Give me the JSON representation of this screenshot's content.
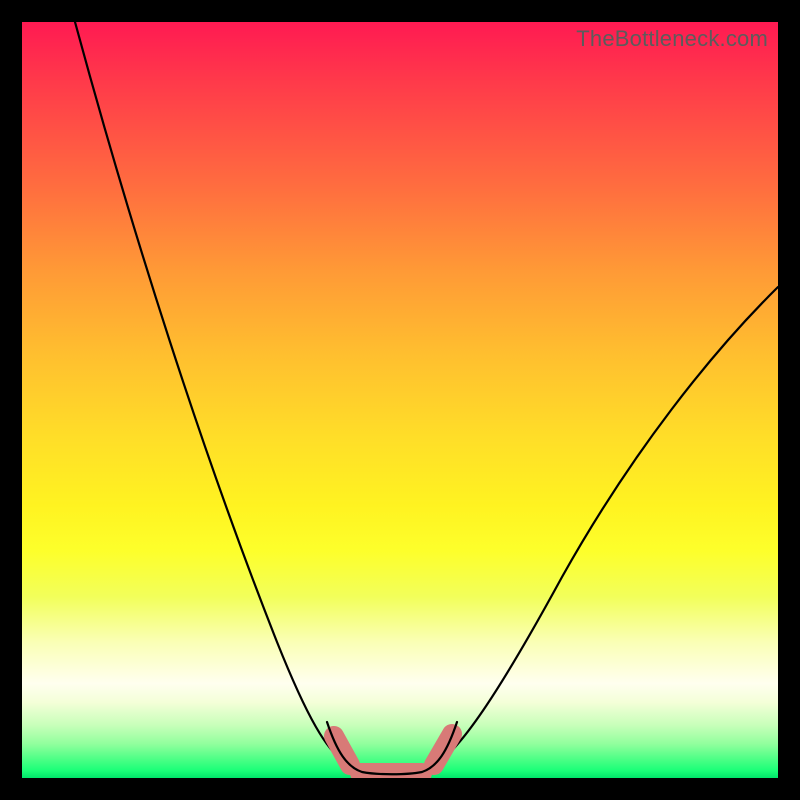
{
  "watermark": "TheBottleneck.com",
  "chart_data": {
    "type": "line",
    "title": "",
    "xlabel": "",
    "ylabel": "",
    "xlim": [
      0,
      100
    ],
    "ylim": [
      0,
      100
    ],
    "grid": false,
    "legend": false,
    "background_gradient_stops": [
      {
        "pos": 0,
        "color": "#ff1a52"
      },
      {
        "pos": 22,
        "color": "#ff6e3f"
      },
      {
        "pos": 44,
        "color": "#ffbf2f"
      },
      {
        "pos": 64,
        "color": "#fff321"
      },
      {
        "pos": 82,
        "color": "#faffb5"
      },
      {
        "pos": 90,
        "color": "#f4ffd8"
      },
      {
        "pos": 97.5,
        "color": "#4dff86"
      },
      {
        "pos": 100,
        "color": "#00e56a"
      }
    ],
    "series": [
      {
        "name": "bottleneck-curve-left",
        "x": [
          7,
          10,
          13,
          16,
          19,
          22,
          25,
          28,
          31,
          34,
          37,
          39,
          41,
          43
        ],
        "y": [
          100,
          92,
          84,
          76,
          68,
          60,
          52,
          44,
          36,
          28,
          20,
          13,
          7,
          3
        ]
      },
      {
        "name": "bottleneck-curve-right",
        "x": [
          55,
          58,
          62,
          66,
          70,
          75,
          80,
          85,
          90,
          95,
          100
        ],
        "y": [
          3,
          7,
          13,
          20,
          27,
          34,
          41,
          48,
          54,
          60,
          65
        ]
      },
      {
        "name": "optimal-flat",
        "x": [
          43,
          46,
          49,
          52,
          55
        ],
        "y": [
          1.0,
          0.5,
          0.5,
          0.5,
          1.0
        ]
      }
    ],
    "highlight_segments": [
      {
        "name": "left-knee",
        "x0": 41,
        "x1": 44,
        "angle_deg": -62
      },
      {
        "name": "flat",
        "x0": 44,
        "x1": 54,
        "angle_deg": 0
      },
      {
        "name": "right-knee",
        "x0": 54,
        "x1": 57,
        "angle_deg": 55
      }
    ],
    "colors": {
      "curve": "#000000",
      "highlight": "#d87a77"
    }
  }
}
